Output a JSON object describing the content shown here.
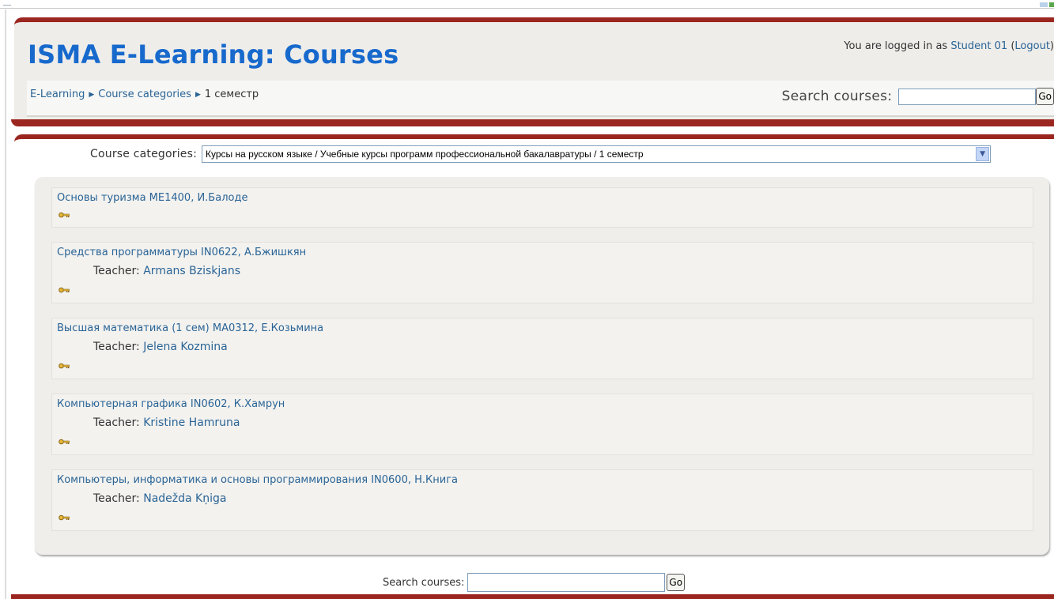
{
  "header": {
    "site_title": "ISMA E-Learning: Courses",
    "login_prefix": "You are logged in as",
    "user_name": "Student 01",
    "logout_open": "(",
    "logout_label": "Logout",
    "logout_close": ")"
  },
  "breadcrumb": {
    "items": [
      {
        "label": "E-Learning"
      },
      {
        "label": "Course categories"
      },
      {
        "label": "1 семестр"
      }
    ]
  },
  "nav_search": {
    "label": "Search courses:",
    "value": "",
    "go_label": "Go"
  },
  "category_selector": {
    "label": "Course categories:",
    "selected": "Курсы на русском языке / Учебные курсы программ профессиональной бакалавратуры / 1 семестр"
  },
  "courses": [
    {
      "name": "Основы туризма ME1400, И.Балоде",
      "teacher_label": "",
      "teacher": ""
    },
    {
      "name": "Средства программатуры IN0622, А.Бжишкян",
      "teacher_label": "Teacher:",
      "teacher": "Armans Bziskjans"
    },
    {
      "name": "Высшая математика (1 сем) MA0312, Е.Козьмина",
      "teacher_label": "Teacher:",
      "teacher": "Jelena Kozmina"
    },
    {
      "name": "Компьютерная графика IN0602, К.Хамрун",
      "teacher_label": "Teacher:",
      "teacher": "Kristine Hamruna"
    },
    {
      "name": "Компьютеры, информатика и основы программирования IN0600, Н.Книга",
      "teacher_label": "Teacher:",
      "teacher": "Nadežda Kņiga"
    }
  ],
  "bottom_search": {
    "label": "Search courses:",
    "value": "",
    "go_label": "Go"
  },
  "colors": {
    "brand_red": "#9b2620",
    "title_blue": "#1769cc",
    "link_blue": "#2a6496"
  },
  "icons": {
    "guest_access": "key-icon",
    "breadcrumb_separator": "triangle-right-icon",
    "dropdown": "chevron-down-icon"
  }
}
